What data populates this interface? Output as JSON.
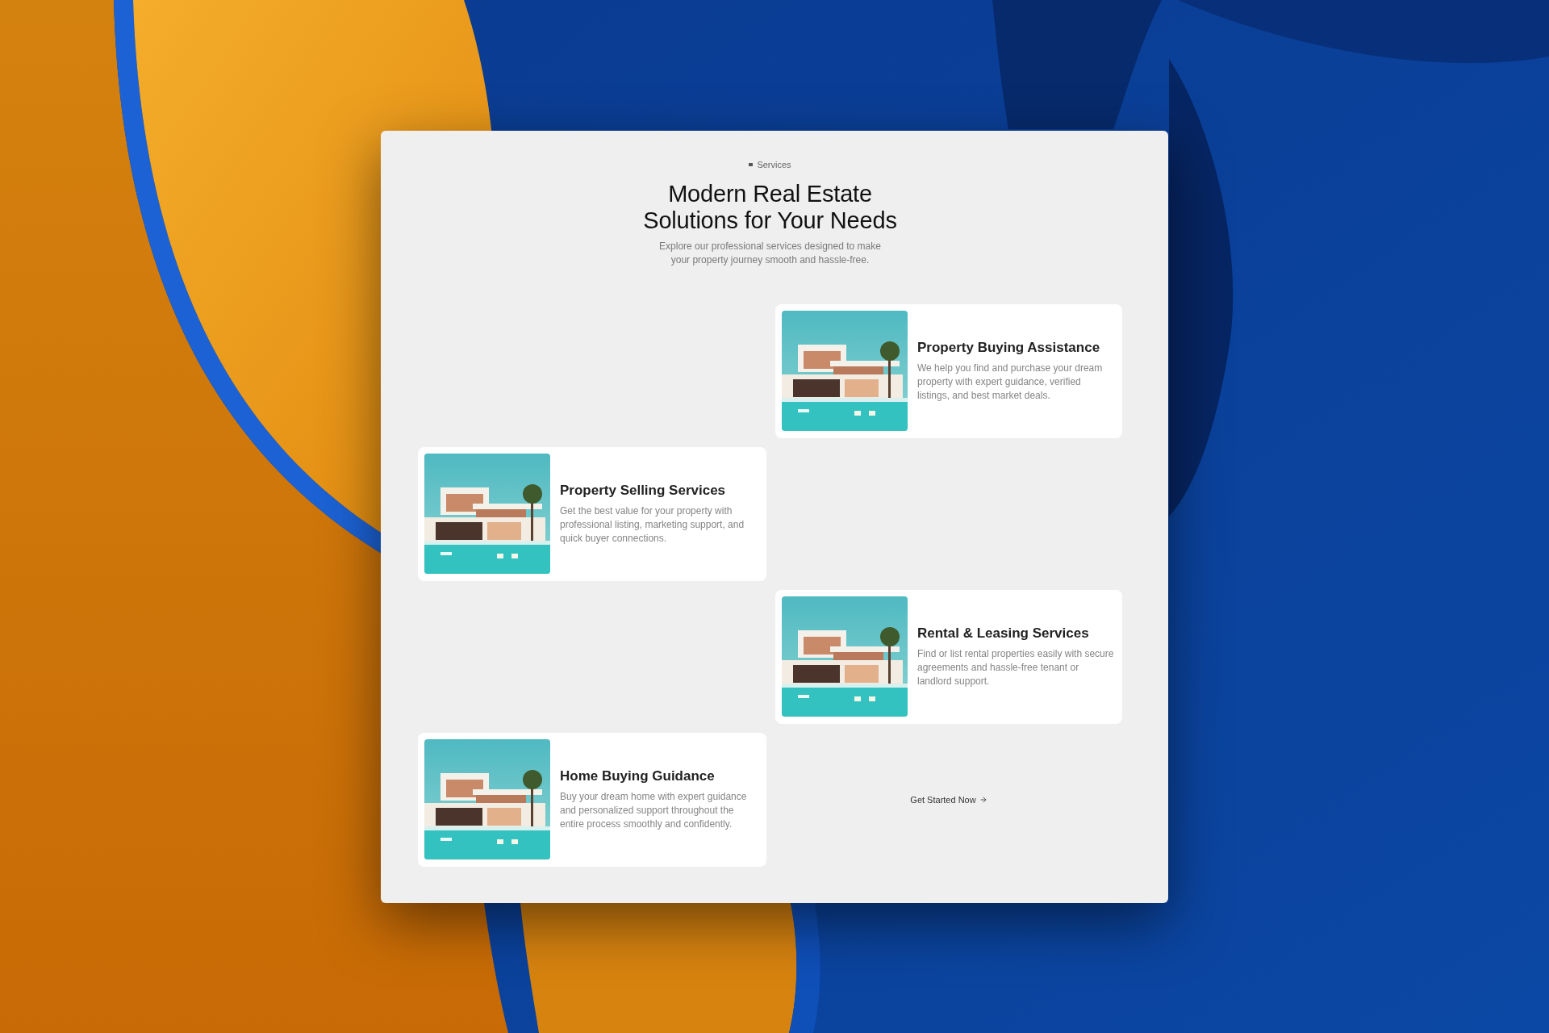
{
  "eyebrow": "Services",
  "heading": "Modern Real Estate Solutions for Your Needs",
  "subtitle": "Explore our professional services designed to make your property journey smooth and hassle-free.",
  "services": [
    {
      "title": "Property Buying Assistance",
      "description": "We help you find and purchase your dream property with expert guidance, verified listings, and best market deals."
    },
    {
      "title": "Property Selling Services",
      "description": "Get the best value for your property with professional listing, marketing support, and quick buyer connections."
    },
    {
      "title": "Rental & Leasing Services",
      "description": "Find or list rental properties easily with secure agreements and hassle-free tenant or landlord support."
    },
    {
      "title": "Home Buying Guidance",
      "description": "Buy your dream home with expert guidance and personalized support throughout the entire process smoothly and confidently."
    }
  ],
  "cta": {
    "label": "Get Started Now"
  }
}
